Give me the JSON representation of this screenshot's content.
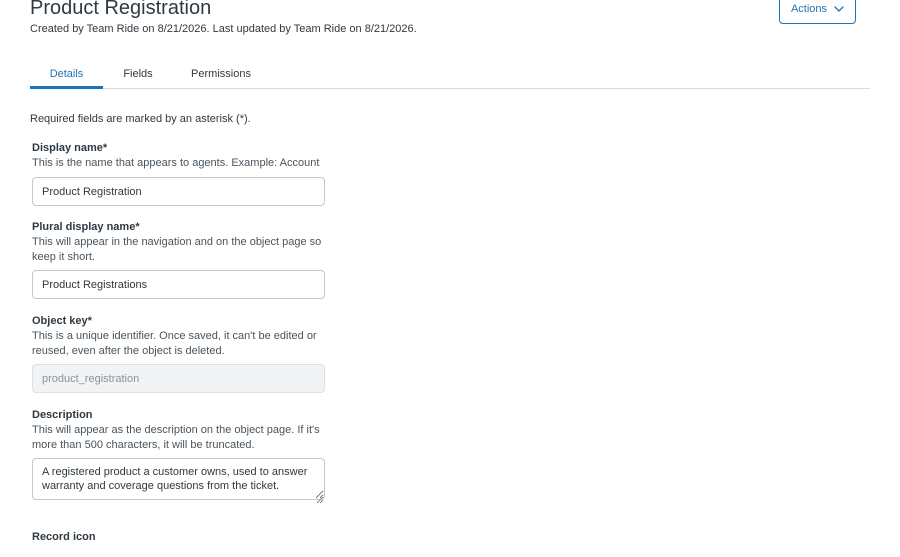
{
  "header": {
    "title": "Product Registration",
    "meta": "Created by Team Ride on 8/21/2026. Last updated by Team Ride on 8/21/2026.",
    "actions_label": "Actions"
  },
  "tabs": [
    {
      "label": "Details",
      "active": true
    },
    {
      "label": "Fields",
      "active": false
    },
    {
      "label": "Permissions",
      "active": false
    }
  ],
  "form": {
    "required_note": "Required fields are marked by an asterisk (*).",
    "display_name": {
      "label": "Display name*",
      "help": "This is the name that appears to agents. Example: Account",
      "value": "Product Registration"
    },
    "plural_display_name": {
      "label": "Plural display name*",
      "help": "This will appear in the navigation and on the object page so keep it short.",
      "value": "Product Registrations"
    },
    "object_key": {
      "label": "Object key*",
      "help": "This is a unique identifier. Once saved, it can't be edited or reused, even after the object is deleted.",
      "value": "product_registration"
    },
    "description": {
      "label": "Description",
      "help": "This will appear as the description on the object page. If it's more than 500 characters, it will be truncated.",
      "value": "A registered product a customer owns, used to answer warranty and coverage questions from the ticket."
    },
    "record_icon": {
      "label": "Record icon"
    }
  },
  "colors": {
    "accent": "#1f73b7",
    "text": "#2f3941",
    "border": "#c2c8cc",
    "disabled_bg": "#f2f3f4"
  }
}
